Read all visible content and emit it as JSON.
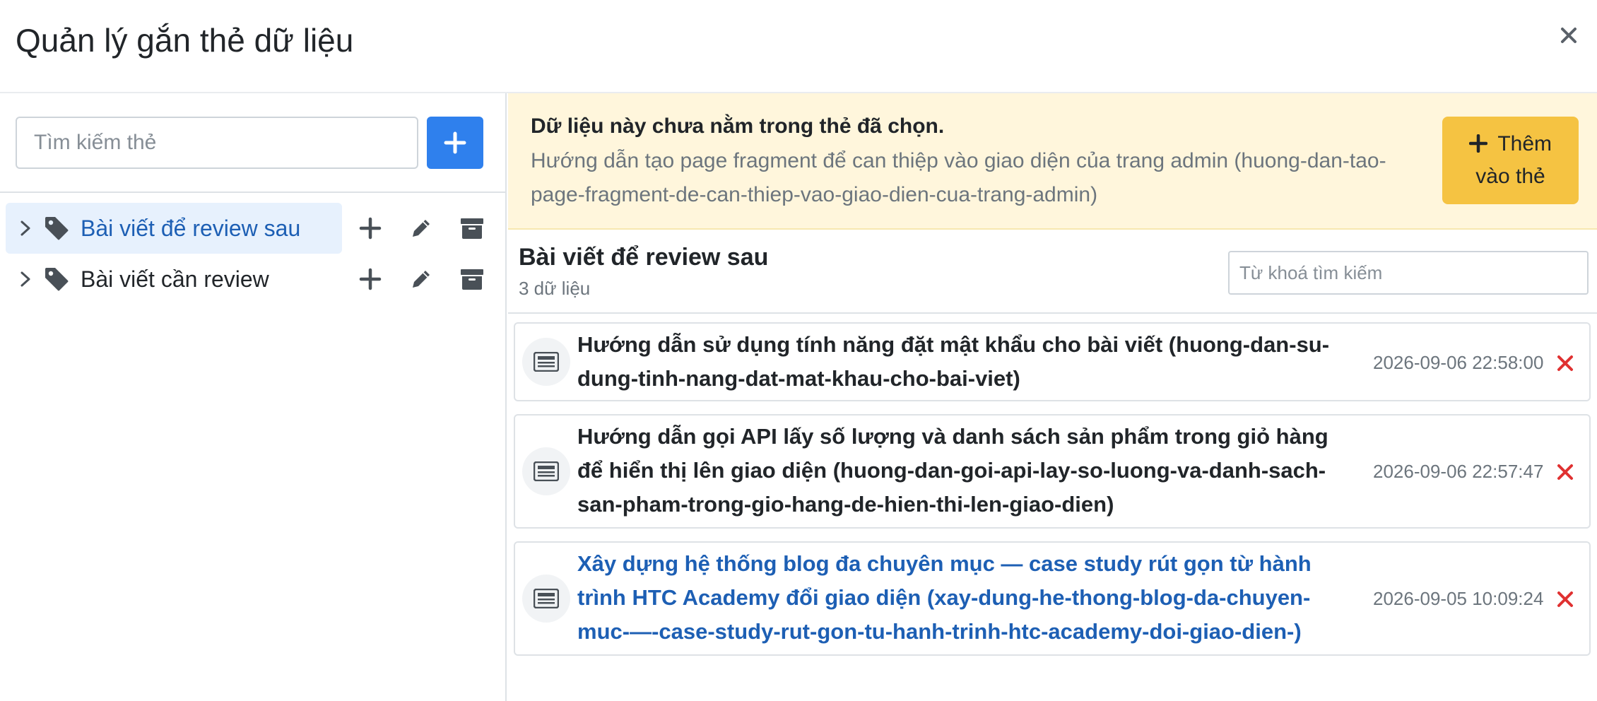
{
  "modal": {
    "title": "Quản lý gắn thẻ dữ liệu"
  },
  "tags": {
    "search_placeholder": "Tìm kiếm thẻ",
    "items": [
      {
        "label": "Bài viết để review sau",
        "active": true
      },
      {
        "label": "Bài viết cần review",
        "active": false
      }
    ]
  },
  "alert": {
    "title": "Dữ liệu này chưa nằm trong thẻ đã chọn.",
    "description": "Hướng dẫn tạo page fragment để can thiệp vào giao diện của trang admin (huong-dan-tao-page-fragment-de-can-thiep-vao-giao-dien-cua-trang-admin)",
    "button_line1": "Thêm",
    "button_line2": "vào thẻ"
  },
  "list": {
    "title": "Bài viết để review sau",
    "count": "3 dữ liệu",
    "search_placeholder": "Từ khoá tìm kiếm",
    "items": [
      {
        "title": "Hướng dẫn sử dụng tính năng đặt mật khẩu cho bài viết (huong-dan-su-dung-tinh-nang-dat-mat-khau-cho-bai-viet)",
        "date": "2026-09-06 22:58:00",
        "is_link": false
      },
      {
        "title": "Hướng dẫn gọi API lấy số lượng và danh sách sản phẩm trong giỏ hàng để hiển thị lên giao diện (huong-dan-goi-api-lay-so-luong-va-danh-sach-san-pham-trong-gio-hang-de-hien-thi-len-giao-dien)",
        "date": "2026-09-06 22:57:47",
        "is_link": false
      },
      {
        "title": "Xây dựng hệ thống blog đa chuyên mục — case study rút gọn từ hành trình HTC Academy đổi giao diện (xay-dung-he-thong-blog-da-chuyen-muc-—-case-study-rut-gon-tu-hanh-trinh-htc-academy-doi-giao-dien-)",
        "date": "2026-09-05 10:09:24",
        "is_link": true
      }
    ]
  },
  "colors": {
    "primary": "#2f80ed",
    "warning_bg": "#fff6dc",
    "warning_button": "#f5c342",
    "active_tag_bg": "#e7f1fd",
    "link": "#1d5fb4",
    "danger": "#e03131"
  },
  "icons": {
    "close": "close-icon",
    "plus": "plus-icon",
    "chevron": "chevron-right-icon",
    "tag": "tag-icon",
    "edit": "pencil-icon",
    "archive": "archive-icon",
    "article": "newspaper-icon",
    "remove": "remove-icon"
  }
}
